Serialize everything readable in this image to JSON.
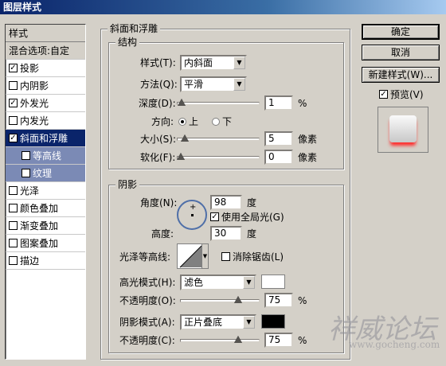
{
  "window": {
    "title": "图层样式"
  },
  "sidebar": {
    "header": "样式",
    "blend_options": "混合选项:自定",
    "items": [
      {
        "label": "投影",
        "checked": true
      },
      {
        "label": "内阴影",
        "checked": false
      },
      {
        "label": "外发光",
        "checked": true
      },
      {
        "label": "内发光",
        "checked": false
      },
      {
        "label": "斜面和浮雕",
        "checked": true,
        "selected": true
      },
      {
        "label": "等高线",
        "checked": false,
        "sub": true
      },
      {
        "label": "纹理",
        "checked": false,
        "sub": true
      },
      {
        "label": "光泽",
        "checked": false
      },
      {
        "label": "颜色叠加",
        "checked": false
      },
      {
        "label": "渐变叠加",
        "checked": false
      },
      {
        "label": "图案叠加",
        "checked": false
      },
      {
        "label": "描边",
        "checked": false
      }
    ]
  },
  "bevel": {
    "section_title": "斜面和浮雕",
    "structure": {
      "title": "结构",
      "style_label": "样式(T):",
      "style_value": "内斜面",
      "technique_label": "方法(Q):",
      "technique_value": "平滑",
      "depth_label": "深度(D):",
      "depth_value": "1",
      "depth_unit": "%",
      "depth_level": 0.01,
      "direction_label": "方向:",
      "direction_up": "上",
      "direction_down": "下",
      "direction_selected": "上",
      "size_label": "大小(S):",
      "size_value": "5",
      "size_unit": "像素",
      "size_level": 0.05,
      "soften_label": "软化(F):",
      "soften_value": "0",
      "soften_unit": "像素",
      "soften_level": 0.0
    },
    "shading": {
      "title": "阴影",
      "angle_label": "角度(N):",
      "angle_value": "98",
      "angle_unit": "度",
      "global_light_label": "使用全局光(G)",
      "global_light_checked": true,
      "altitude_label": "高度:",
      "altitude_value": "30",
      "altitude_unit": "度",
      "gloss_contour_label": "光泽等高线:",
      "anti_alias_label": "消除锯齿(L)",
      "anti_alias_checked": false,
      "highlight_mode_label": "高光模式(H):",
      "highlight_mode_value": "滤色",
      "highlight_color": "#ffffff",
      "highlight_opacity_label": "不透明度(O):",
      "highlight_opacity_value": "75",
      "highlight_opacity_unit": "%",
      "highlight_opacity_level": 0.75,
      "shadow_mode_label": "阴影模式(A):",
      "shadow_mode_value": "正片叠底",
      "shadow_color": "#000000",
      "shadow_opacity_label": "不透明度(C):",
      "shadow_opacity_value": "75",
      "shadow_opacity_unit": "%",
      "shadow_opacity_level": 0.75
    }
  },
  "buttons": {
    "ok": "确定",
    "cancel": "取消",
    "new_style": "新建样式(W)...",
    "preview_label": "预览(V)",
    "preview_checked": true
  },
  "watermark": {
    "line1": "祥威论坛",
    "line2": "www.gocheng.com"
  },
  "colors": {
    "selection": "#0a246a",
    "sub_item": "#7b8ab5",
    "preview_glow": "#ff2a2a"
  }
}
